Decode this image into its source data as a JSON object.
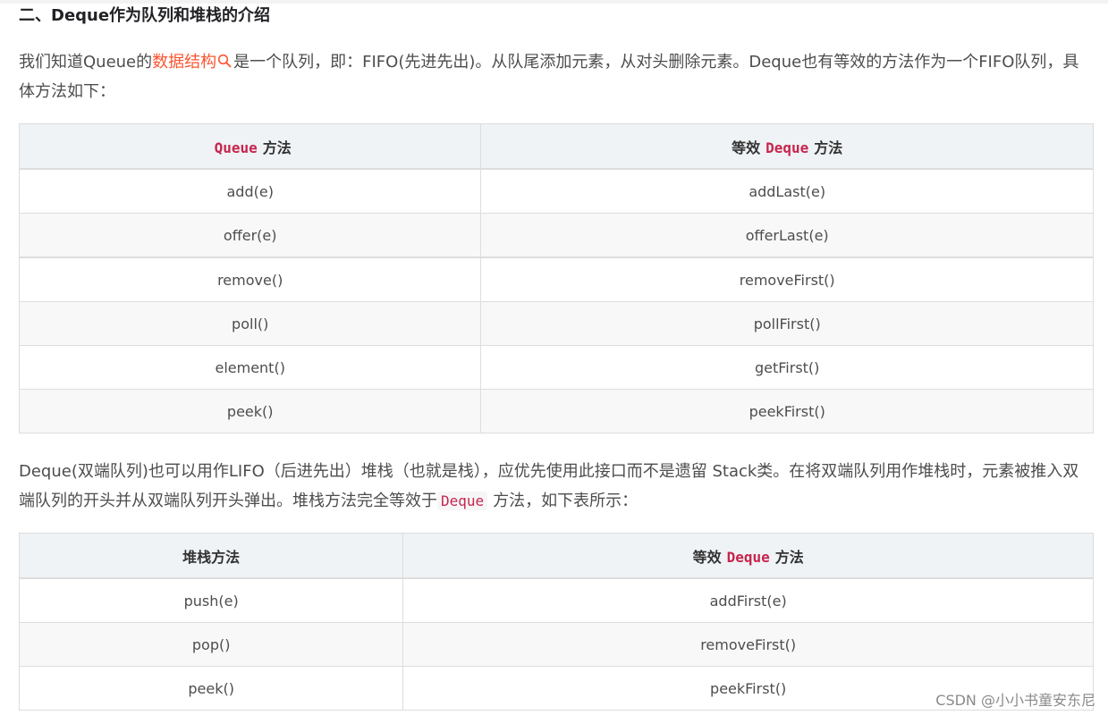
{
  "section_title": "二、Deque作为队列和堆栈的介绍",
  "intro": {
    "before_link": "我们知道Queue的",
    "link_text": "数据结构",
    "after_link": "是一个队列，即：FIFO(先进先出)。从队尾添加元素，从对头删除元素。Deque也有等效的方法作为一个FIFO队列，具体方法如下："
  },
  "table1": {
    "header_col1": {
      "code": "Queue",
      "suffix": "方法"
    },
    "header_col2": {
      "prefix": "等效",
      "code": "Deque",
      "suffix": "方法"
    },
    "rows": [
      {
        "queue": "add(e)",
        "deque": "addLast(e)"
      },
      {
        "queue": "offer(e)",
        "deque": "offerLast(e)"
      },
      {
        "queue": "remove()",
        "deque": "removeFirst()"
      },
      {
        "queue": "poll()",
        "deque": "pollFirst()"
      },
      {
        "queue": "element()",
        "deque": "getFirst()"
      },
      {
        "queue": "peek()",
        "deque": "peekFirst()"
      }
    ]
  },
  "stack_para": {
    "before_code": "Deque(双端队列)也可以用作LIFO（后进先出）堆栈（也就是栈），应优先使用此接口而不是遗留 Stack类。在将双端队列用作堆栈时，元素被推入双端队列的开头并从双端队列开头弹出。堆栈方法完全等效于",
    "code": "Deque",
    "after_code": "方法，如下表所示："
  },
  "table2": {
    "header_col1": "堆栈方法",
    "header_col2": {
      "prefix": "等效",
      "code": "Deque",
      "suffix": "方法"
    },
    "rows": [
      {
        "stack": "push(e)",
        "deque": "addFirst(e)"
      },
      {
        "stack": "pop()",
        "deque": "removeFirst()"
      },
      {
        "stack": "peek()",
        "deque": "peekFirst()"
      }
    ]
  },
  "watermark": "CSDN @小小书童安东尼",
  "colors": {
    "link": "#fc5531",
    "code": "#c7254e",
    "header_bg": "#eff3f5"
  },
  "icons": {
    "link_search": "search-icon"
  }
}
